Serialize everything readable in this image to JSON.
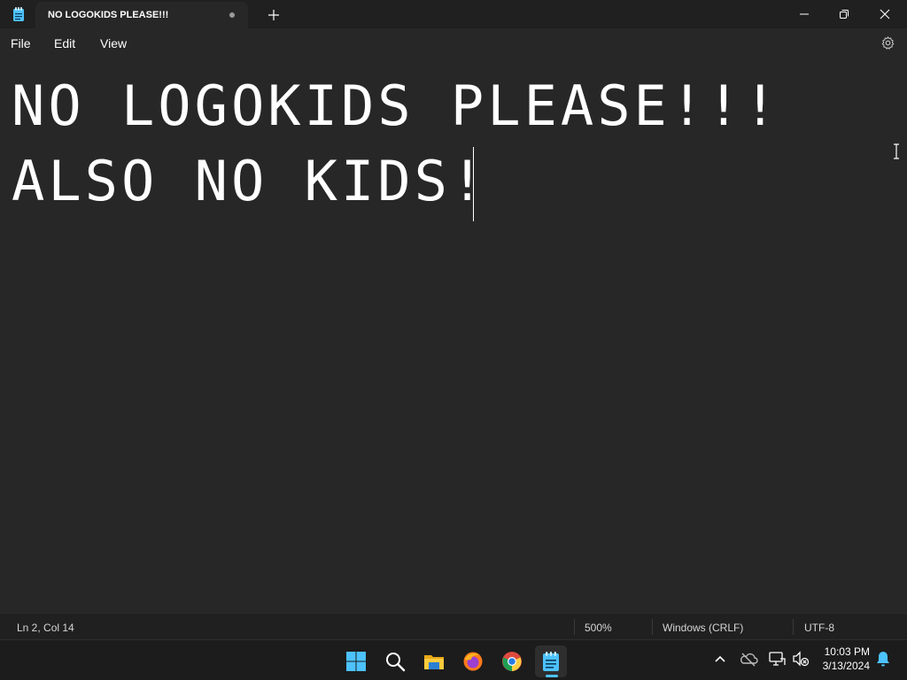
{
  "titlebar": {
    "tab_title": "NO LOGOKIDS PLEASE!!!",
    "app_icon": "notepad-icon",
    "new_tab_icon": "plus-icon",
    "controls": [
      "minimize-icon",
      "restore-icon",
      "close-icon"
    ]
  },
  "menu": {
    "items": [
      {
        "label": "File"
      },
      {
        "label": "Edit"
      },
      {
        "label": "View"
      }
    ],
    "settings_icon": "gear-icon"
  },
  "editor": {
    "lines": [
      "NO LOGOKIDS PLEASE!!!",
      "ALSO NO KIDS!"
    ]
  },
  "statusbar": {
    "position": "Ln 2, Col 14",
    "zoom": "500%",
    "line_ending": "Windows (CRLF)",
    "encoding": "UTF-8"
  },
  "taskbar": {
    "apps": [
      "start-icon",
      "search-icon",
      "file-explorer-icon",
      "firefox-icon",
      "chrome-icon",
      "notepad-icon"
    ],
    "tray": [
      "chevron-up-icon",
      "onedrive-icon",
      "network-icon",
      "volume-muted-icon",
      "notification-bell-icon"
    ],
    "time": "10:03 PM",
    "date": "3/13/2024"
  },
  "colors": {
    "accent": "#4cc2ff",
    "background": "#202020",
    "editor_background": "#272727",
    "text": "#ffffff"
  }
}
